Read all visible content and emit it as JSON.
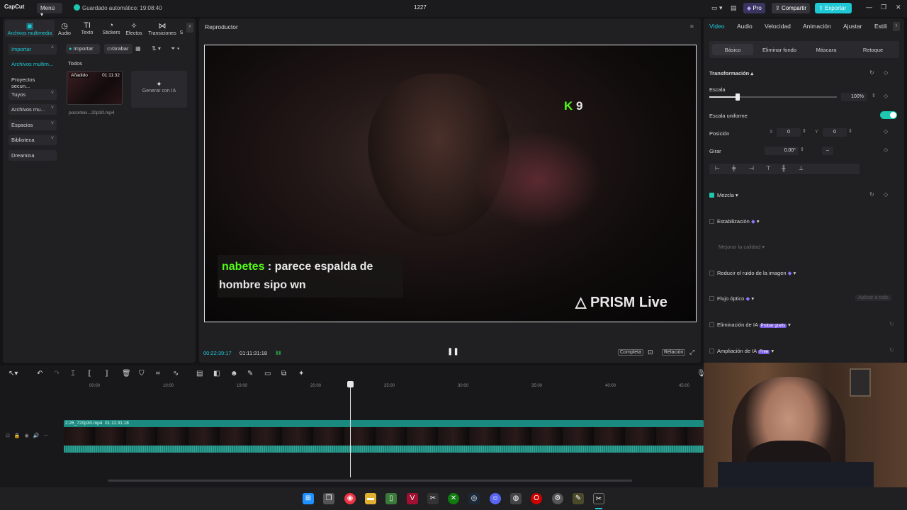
{
  "topbar": {
    "logo": "CapCut",
    "menu": "Menú",
    "autosave": "Guardado automático: 19:08:40",
    "project_title": "1227",
    "pro": "Pro",
    "share": "Compartir",
    "export": "Exportar"
  },
  "left_panel": {
    "tabs": [
      {
        "label": "Archivos multimedia",
        "icon": "media-icon"
      },
      {
        "label": "Audio",
        "icon": "audio-icon"
      },
      {
        "label": "Texto",
        "icon": "text-icon"
      },
      {
        "label": "Stickers",
        "icon": "sticker-icon"
      },
      {
        "label": "Efectos",
        "icon": "effects-icon"
      },
      {
        "label": "Transiciones",
        "icon": "transitions-icon"
      },
      {
        "label": "S",
        "icon": "more-icon"
      }
    ],
    "sidebar": [
      {
        "label": "Importar"
      },
      {
        "label": "Archivos multim..."
      },
      {
        "label": "Proyectos secun..."
      },
      {
        "label": "Tuyos"
      },
      {
        "label": "Archivos mu..."
      },
      {
        "label": "Espacios"
      },
      {
        "label": "Biblioteca"
      },
      {
        "label": "Dreamina"
      }
    ],
    "import_btn": "Importar",
    "record_btn": "Grabar",
    "filter_all": "Todos",
    "media_item": {
      "badge": "Añadido",
      "duration": "01:11:32",
      "filename": "pocorteix...20p30.mp4"
    },
    "generate_ai": "Generar con IA"
  },
  "player": {
    "title": "Reproductor",
    "current_time": "00:22:39:17",
    "total_time": "01:11:31:18",
    "full_btn": "Completa",
    "ratio_btn": "Relación",
    "overlay_username": "nabetes",
    "overlay_message_1": ": parece espalda de",
    "overlay_message_2": "hombre sipo wn",
    "watermark": "PRISM Live",
    "kick_count": "9"
  },
  "right_panel": {
    "tabs": [
      "Video",
      "Audio",
      "Velocidad",
      "Animación",
      "Ajustar",
      "Estili"
    ],
    "subtabs": [
      "Básico",
      "Eliminar fondo",
      "Máscara",
      "Retoque"
    ],
    "transform": "Transformación",
    "scale": "Escala",
    "scale_value": "100%",
    "scale_fraction": 0.22,
    "uniform_scale": "Escala uniforme",
    "position": "Posición",
    "pos_x_label": "X",
    "pos_x": "0",
    "pos_y_label": "Y",
    "pos_y": "0",
    "rotate": "Girar",
    "rotate_value": "0.00°",
    "blend": "Mezcla",
    "stabilization": "Estabilización",
    "improve_quality": "Mejorar la calidad",
    "reduce_noise": "Reducir el ruido de la imagen",
    "optical_flow": "Flujo óptico",
    "apply_all": "Aplicar a todo",
    "ai_removal": "Eliminación de IA",
    "try_free": "Probar gratis",
    "ai_upscale": "Ampliación de IA",
    "free": "Free"
  },
  "timeline": {
    "ticks": [
      "00:00",
      "10:00",
      "19:00",
      "20:00",
      "25:00",
      "30:00",
      "35:00",
      "40:00",
      "45:00"
    ],
    "clip_name": "2:26_720p30.mp4",
    "clip_duration": "01:11:31:18"
  },
  "colors": {
    "accent": "#1ec8d4",
    "clip": "#1a8a80",
    "export": "#1ec8d4"
  }
}
